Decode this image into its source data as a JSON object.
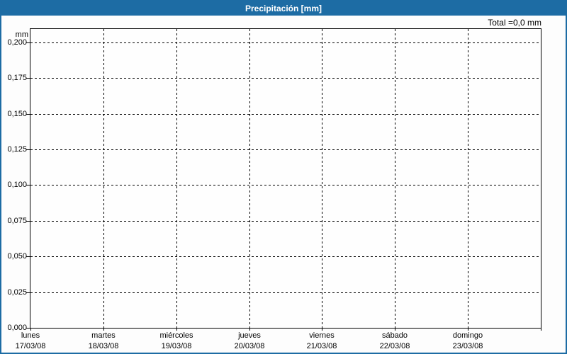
{
  "window": {
    "title": "Precipitación [mm]"
  },
  "chart_data": {
    "type": "bar",
    "title": "Precipitación [mm]",
    "total_label": "Total =0,0 mm",
    "total_mm": 0.0,
    "ylabel": "mm",
    "xlabel": "",
    "ylim": [
      0,
      0.2094
    ],
    "grid": "dashed",
    "legend": "none",
    "yticks": [
      {
        "value": 0.2,
        "label": "0,200"
      },
      {
        "value": 0.175,
        "label": "0,175"
      },
      {
        "value": 0.15,
        "label": "0,150"
      },
      {
        "value": 0.125,
        "label": "0,125"
      },
      {
        "value": 0.1,
        "label": "0,100"
      },
      {
        "value": 0.075,
        "label": "0,075"
      },
      {
        "value": 0.05,
        "label": "0,050"
      },
      {
        "value": 0.025,
        "label": "0,025"
      },
      {
        "value": 0.0,
        "label": "0,000"
      }
    ],
    "categories": [
      {
        "day": "lunes",
        "date": "17/03/08"
      },
      {
        "day": "martes",
        "date": "18/03/08"
      },
      {
        "day": "miércoles",
        "date": "19/03/08"
      },
      {
        "day": "jueves",
        "date": "20/03/08"
      },
      {
        "day": "viernes",
        "date": "21/03/08"
      },
      {
        "day": "sábado",
        "date": "22/03/08"
      },
      {
        "day": "domingo",
        "date": "23/03/08"
      }
    ],
    "series": [
      {
        "name": "Precipitación",
        "values": [
          0,
          0,
          0,
          0,
          0,
          0,
          0
        ]
      }
    ]
  },
  "colors": {
    "titlebar": "#1d6ca4",
    "border": "#1d6ca4",
    "grid": "#000000",
    "text": "#000000",
    "background": "#fdfdfd"
  }
}
